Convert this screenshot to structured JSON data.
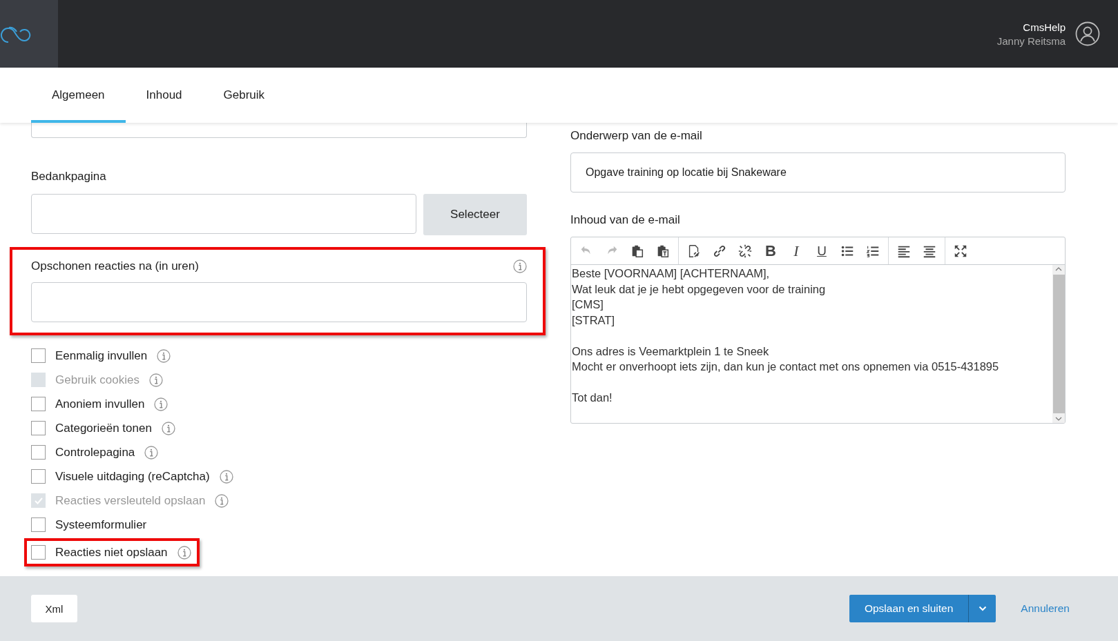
{
  "header": {
    "app_name": "CmsHelp",
    "user_name": "Janny Reitsma"
  },
  "tabs": [
    {
      "label": "Algemeen",
      "selected": true
    },
    {
      "label": "Inhoud",
      "selected": false
    },
    {
      "label": "Gebruik",
      "selected": false
    }
  ],
  "left": {
    "thank_page": {
      "label": "Bedankpagina",
      "button": "Selecteer"
    },
    "cleanup": {
      "label": "Opschonen reacties na (in uren)",
      "highlighted": true
    },
    "options": [
      {
        "label": "Eenmalig invullen",
        "checked": false,
        "disabled": false,
        "info": true,
        "highlighted": false
      },
      {
        "label": "Gebruik cookies",
        "checked": false,
        "disabled": true,
        "info": true,
        "highlighted": false
      },
      {
        "label": "Anoniem invullen",
        "checked": false,
        "disabled": false,
        "info": true,
        "highlighted": false
      },
      {
        "label": "Categorieën tonen",
        "checked": false,
        "disabled": false,
        "info": true,
        "highlighted": false
      },
      {
        "label": "Controlepagina",
        "checked": false,
        "disabled": false,
        "info": true,
        "highlighted": false
      },
      {
        "label": "Visuele uitdaging (reCaptcha)",
        "checked": false,
        "disabled": false,
        "info": true,
        "highlighted": false
      },
      {
        "label": "Reacties versleuteld opslaan",
        "checked": true,
        "disabled": true,
        "info": true,
        "highlighted": false
      },
      {
        "label": "Systeemformulier",
        "checked": false,
        "disabled": false,
        "info": false,
        "highlighted": false
      },
      {
        "label": "Reacties niet opslaan",
        "checked": false,
        "disabled": false,
        "info": true,
        "highlighted": true
      }
    ]
  },
  "right": {
    "subject": {
      "label": "Onderwerp van de e-mail",
      "value": "Opgave training op locatie bij Snakeware"
    },
    "body": {
      "label": "Inhoud van de e-mail",
      "toolbar": [
        [
          {
            "kind": "undo",
            "disabled": true
          },
          {
            "kind": "redo",
            "disabled": true
          },
          {
            "kind": "paste",
            "disabled": false
          },
          {
            "kind": "paste-text",
            "disabled": false
          }
        ],
        [
          {
            "kind": "doc-link",
            "disabled": false
          },
          {
            "kind": "link",
            "disabled": false
          },
          {
            "kind": "unlink",
            "disabled": false
          },
          {
            "kind": "bold",
            "label": "B",
            "disabled": false
          },
          {
            "kind": "italic",
            "label": "I",
            "disabled": false
          },
          {
            "kind": "underline",
            "label": "U",
            "disabled": false
          },
          {
            "kind": "bullets",
            "disabled": false
          },
          {
            "kind": "numbers",
            "disabled": false
          }
        ],
        [
          {
            "kind": "align-left",
            "disabled": false
          },
          {
            "kind": "align-center",
            "disabled": false
          }
        ],
        [
          {
            "kind": "maximize",
            "disabled": false
          }
        ]
      ],
      "text": "Beste [VOORNAAM] [ACHTERNAAM],\nWat leuk dat je je hebt opgegeven voor de training\n[CMS]\n[STRAT]\n\nOns adres is Veemarktplein 1 te Sneek\nMocht er onverhoopt iets zijn, dan kun je contact met ons opnemen via 0515-431895\n\nTot dan!"
    }
  },
  "footer": {
    "xml_button": "Xml",
    "save_button": "Opslaan en sluiten",
    "cancel_link": "Annuleren"
  }
}
